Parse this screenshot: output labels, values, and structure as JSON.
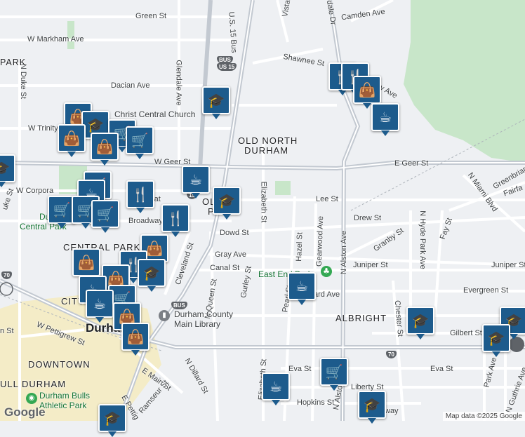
{
  "map": {
    "colors": {
      "background": "#eef0f3",
      "street": "#ffffff",
      "major_road": "#bcc3cc",
      "park": "#c7e9c6",
      "downtown": "#f5ecc4",
      "pin": "#1d5b8c"
    },
    "streets": {
      "green_st": "Green St",
      "camden_ave": "Camden Ave",
      "w_markham_ave": "W Markham Ave",
      "shawnee_st": "Shawnee St",
      "dacian_ave": "Dacian Ave",
      "glendale_ave": "Glendale Ave",
      "us15_bus": "U.S. 15 Bus",
      "n_duke_st_top": "N Duke St",
      "w_trinity": "W Trinity",
      "w_geer_st": "W Geer St",
      "e_geer_st": "E Geer St",
      "w_corpora": "W Corpora",
      "broadway": "Broadway",
      "lee_st": "Lee St",
      "drew_st": "Drew St",
      "dowd_st": "Dowd St",
      "elizabeth_st": "Elizabeth St",
      "elizabeth_st_bottom": "Elizabeth St",
      "gearwood_ave": "Gearwood Ave",
      "hazel_st": "Hazel St",
      "n_alston_ave": "N Alston Ave",
      "granby_st": "Granby St",
      "juniper_st": "Juniper St",
      "juniper_st_east": "Juniper St",
      "gray_ave": "Gray Ave",
      "canal_st": "Canal St",
      "gurley_st": "Gurley St",
      "cleveland_st": "Cleveland St",
      "n_queen_st": "N Queen St",
      "pearl_st": "Pearl St",
      "ard_ave": "ard Ave",
      "evergreen_st": "Evergreen St",
      "gilbert_st": "Gilbert St",
      "chester_st": "Chester St",
      "n_hyde_park_ave": "N Hyde Park Ave",
      "fay_st": "Fay St",
      "n_miami_blvd": "N Miami Blvd",
      "greenbriar": "Greenbriar",
      "fairfa": "Fairfa",
      "eva_st": "Eva St",
      "eva_st_east": "Eva St",
      "liberty_st": "Liberty St",
      "hopkins_st": "Hopkins St",
      "n_alston_bottom": "N Alston",
      "park_ave": "Park Ave",
      "n_guthrie_ave": "N Guthrie Ave",
      "e_main_st": "E Main St",
      "ramseur_st": "Ramseur St",
      "e_pettig": "E Pettig",
      "n_dillard_st": "N Dillard St",
      "w_pettigrew_st": "W Pettigrew St",
      "n_st": "n St",
      "uke_st": "uke St",
      "vista": "Vista",
      "dale_dr": "dale Dr",
      "y_ave": "y Ave",
      "h": "H",
      "w_rat": "rat"
    },
    "areas": {
      "park": "PARK",
      "old_north_durham_1": "OLD NORTH",
      "old_north_durham_2": "DURHAM",
      "old_east": "OL  E",
      "old_east_2": "P  S",
      "central_park": "CENTRAL PARK",
      "city": "CITY",
      "durham": "Durham",
      "downtown": "DOWNTOWN",
      "bull_durham": "ULL DURHAM",
      "albright": "ALBRIGHT"
    },
    "places": {
      "christ_central": "Christ Central Church",
      "durham_central_park_1": "Durham",
      "durham_central_park_2": "Central Park",
      "east_end_park": "East End Park",
      "durham_county_library_1": "Durham County",
      "durham_county_library_2": "Main Library",
      "durham_bulls_1": "Durham Bulls",
      "durham_bulls_2": "Athletic Park",
      "academy": "way"
    },
    "shields": {
      "us15": "US\n15",
      "bus": "BUS",
      "nc70": "70",
      "nc70_left": "70"
    },
    "google_logo": "Google",
    "attribution": "Map data ©2025 Google"
  }
}
